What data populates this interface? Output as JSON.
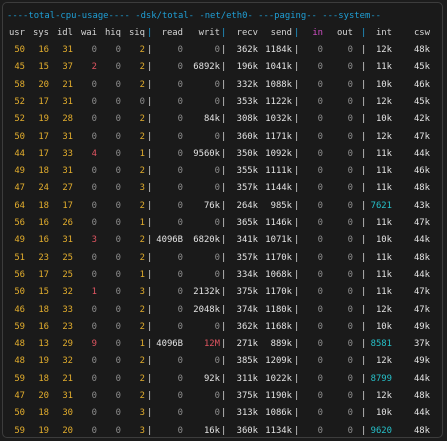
{
  "group_headers": "----total-cpu-usage---- -dsk/total- -net/eth0- ---paging-- ---system--",
  "column_headers": [
    "usr",
    "sys",
    "idl",
    "wai",
    "hiq",
    "siq",
    "read",
    "writ",
    "recv",
    "send",
    "in",
    "out",
    "int",
    "csw"
  ],
  "separators": {
    "cpu_dsk": "|",
    "dsk_net": "|",
    "net_paging": "|",
    "paging_system": "|"
  },
  "rows": [
    [
      "50",
      "16",
      "31",
      "0",
      "0",
      "2",
      "0",
      "0",
      "362k",
      "1184k",
      "0",
      "0",
      "12k",
      "48k"
    ],
    [
      "45",
      "15",
      "37",
      "2",
      "0",
      "2",
      "0",
      "6892k",
      "196k",
      "1041k",
      "0",
      "0",
      "11k",
      "45k"
    ],
    [
      "58",
      "20",
      "21",
      "0",
      "0",
      "2",
      "0",
      "0",
      "332k",
      "1088k",
      "0",
      "0",
      "10k",
      "46k"
    ],
    [
      "52",
      "17",
      "31",
      "0",
      "0",
      "0",
      "0",
      "0",
      "353k",
      "1122k",
      "0",
      "0",
      "12k",
      "45k"
    ],
    [
      "52",
      "19",
      "28",
      "0",
      "0",
      "2",
      "0",
      "84k",
      "308k",
      "1032k",
      "0",
      "0",
      "10k",
      "42k"
    ],
    [
      "50",
      "17",
      "31",
      "0",
      "0",
      "2",
      "0",
      "0",
      "360k",
      "1171k",
      "0",
      "0",
      "12k",
      "47k"
    ],
    [
      "44",
      "17",
      "33",
      "4",
      "0",
      "1",
      "0",
      "9560k",
      "350k",
      "1092k",
      "0",
      "0",
      "11k",
      "44k"
    ],
    [
      "49",
      "18",
      "31",
      "0",
      "0",
      "2",
      "0",
      "0",
      "355k",
      "1111k",
      "0",
      "0",
      "11k",
      "46k"
    ],
    [
      "47",
      "24",
      "27",
      "0",
      "0",
      "3",
      "0",
      "0",
      "357k",
      "1144k",
      "0",
      "0",
      "11k",
      "48k"
    ],
    [
      "64",
      "18",
      "17",
      "0",
      "0",
      "2",
      "0",
      "76k",
      "264k",
      "985k",
      "0",
      "0",
      "7621",
      "43k"
    ],
    [
      "56",
      "16",
      "26",
      "0",
      "0",
      "1",
      "0",
      "0",
      "365k",
      "1146k",
      "0",
      "0",
      "11k",
      "47k"
    ],
    [
      "49",
      "16",
      "31",
      "3",
      "0",
      "2",
      "4096B",
      "6820k",
      "341k",
      "1071k",
      "0",
      "0",
      "10k",
      "44k"
    ],
    [
      "51",
      "23",
      "25",
      "0",
      "0",
      "2",
      "0",
      "0",
      "357k",
      "1170k",
      "0",
      "0",
      "11k",
      "48k"
    ],
    [
      "56",
      "17",
      "25",
      "0",
      "0",
      "1",
      "0",
      "0",
      "334k",
      "1068k",
      "0",
      "0",
      "11k",
      "44k"
    ],
    [
      "50",
      "15",
      "32",
      "1",
      "0",
      "3",
      "0",
      "2132k",
      "375k",
      "1170k",
      "0",
      "0",
      "11k",
      "47k"
    ],
    [
      "46",
      "18",
      "33",
      "0",
      "0",
      "2",
      "0",
      "2048k",
      "374k",
      "1180k",
      "0",
      "0",
      "12k",
      "47k"
    ],
    [
      "59",
      "16",
      "23",
      "0",
      "0",
      "2",
      "0",
      "0",
      "362k",
      "1168k",
      "0",
      "0",
      "10k",
      "49k"
    ],
    [
      "48",
      "13",
      "29",
      "9",
      "0",
      "1",
      "4096B",
      "12M",
      "271k",
      "889k",
      "0",
      "0",
      "8581",
      "37k"
    ],
    [
      "48",
      "19",
      "32",
      "0",
      "0",
      "2",
      "0",
      "0",
      "385k",
      "1209k",
      "0",
      "0",
      "12k",
      "49k"
    ],
    [
      "59",
      "18",
      "21",
      "0",
      "0",
      "2",
      "0",
      "92k",
      "311k",
      "1022k",
      "0",
      "0",
      "8799",
      "44k"
    ],
    [
      "47",
      "20",
      "31",
      "0",
      "0",
      "2",
      "0",
      "0",
      "375k",
      "1190k",
      "0",
      "0",
      "12k",
      "48k"
    ],
    [
      "50",
      "18",
      "30",
      "0",
      "0",
      "3",
      "0",
      "0",
      "313k",
      "1086k",
      "0",
      "0",
      "10k",
      "44k"
    ],
    [
      "59",
      "19",
      "20",
      "0",
      "0",
      "3",
      "0",
      "16k",
      "360k",
      "1134k",
      "0",
      "0",
      "9620",
      "48k"
    ]
  ],
  "colors": {
    "background": "#1a1a1a",
    "header_group": "#1f9fd6",
    "value_yellow": "#e2ad2d",
    "value_zero": "#8d8d8d",
    "value_white": "#e4e4e4",
    "value_red": "#e05561",
    "value_cyan": "#26c0c9",
    "paging_in_header": "#d24fc6"
  }
}
